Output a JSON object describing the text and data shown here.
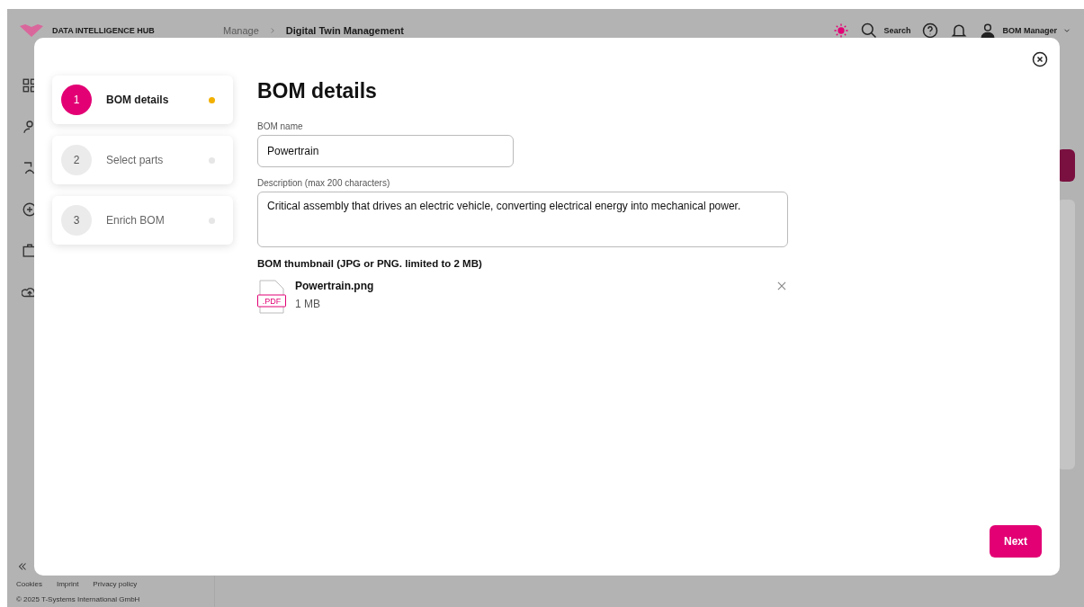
{
  "header": {
    "brand": "DATA INTELLIGENCE HUB",
    "breadcrumb": [
      {
        "label": "Manage",
        "current": false
      },
      {
        "label": "Digital Twin Management",
        "current": true
      }
    ],
    "search": "Search",
    "user": "BOM Manager"
  },
  "footer": {
    "links": [
      "Cookies",
      "Imprint",
      "Privacy policy"
    ],
    "copyright": "© 2025 T-Systems International GmbH"
  },
  "steps": [
    {
      "number": "1",
      "label": "BOM details",
      "selected": true
    },
    {
      "number": "2",
      "label": "Select parts",
      "selected": false
    },
    {
      "number": "3",
      "label": "Enrich BOM",
      "selected": false
    }
  ],
  "form": {
    "title": "BOM details",
    "name_label": "BOM name",
    "name_value": "Powertrain",
    "description_label": "Description (max 200 characters)",
    "description_value": "Critical assembly that drives an electric vehicle, converting electrical energy into mechanical power.",
    "thumbnail_label": "BOM thumbnail (JPG or PNG. limited to 2 MB)",
    "file": {
      "badge": ".PDF",
      "name": "Powertrain.png",
      "size": "1 MB"
    }
  },
  "next_button": "Next"
}
